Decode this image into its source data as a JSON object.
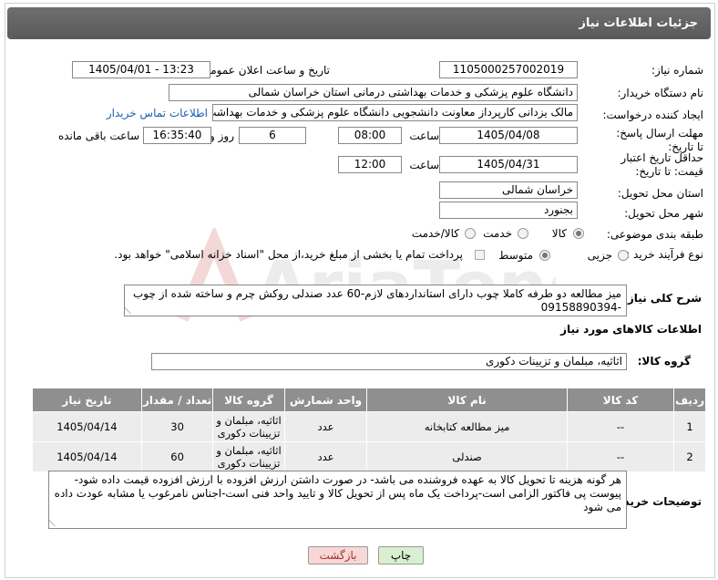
{
  "header": {
    "title": "جزئیات اطلاعات نیاز"
  },
  "fields": {
    "need_number_label": "شماره نیاز:",
    "need_number": "1105000257002019",
    "announce_label": "تاریخ و ساعت اعلان عمومی:",
    "announce_value": "1405/04/01 - 13:23",
    "buyer_org_label": "نام دستگاه خریدار:",
    "buyer_org": "دانشگاه علوم پزشکی و خدمات بهداشتی درمانی استان خراسان شمالی",
    "creator_label": "ایجاد کننده درخواست:",
    "creator": "مالک یزدانی کارپرداز معاونت دانشجویی دانشگاه علوم پزشکی و خدمات بهداشت",
    "contact_link": "اطلاعات تماس خریدار",
    "deadline_label": "مهلت ارسال پاسخ: تا تاریخ:",
    "deadline_date": "1405/04/08",
    "time_label": "ساعت",
    "deadline_time": "08:00",
    "days_value": "6",
    "days_label": "روز و",
    "remaining_time": "16:35:40",
    "remaining_label": "ساعت باقی مانده",
    "min_price_label": "حداقل تاریخ اعتبار قیمت: تا تاریخ:",
    "min_price_date": "1405/04/31",
    "min_price_time_label": "ساعت",
    "min_price_time": "12:00",
    "province_label": "استان محل تحویل:",
    "province": "خراسان شمالی",
    "city_label": "شهر محل تحویل:",
    "city": "بجنورد",
    "category_label": "طبقه بندی موضوعی:",
    "category_options": [
      "کالا",
      "خدمت",
      "کالا/خدمت"
    ],
    "process_label": "نوع فرآیند خرید :",
    "process_options": [
      "جزیی",
      "متوسط"
    ],
    "payment_note": "پرداخت تمام یا بخشی از مبلغ خرید،از محل \"اسناد خزانه اسلامی\" خواهد بود."
  },
  "description": {
    "label": "شرح کلی نیاز:",
    "text": "میز مطالعه دو طرفه کاملا چوب دارای استانداردهای لازم-60 عدد صندلی روکش چرم و ساخته شده از چوب -09158890394"
  },
  "goods": {
    "section_title": "اطلاعات کالاهای مورد نیاز",
    "group_label": "گروه کالا:",
    "group_value": "اثاثیه، مبلمان و تزیینات دکوری"
  },
  "table": {
    "headers": [
      "ردیف",
      "کد کالا",
      "نام کالا",
      "واحد شمارش",
      "گروه کالا",
      "تعداد / مقدار",
      "تاریخ نیاز"
    ],
    "rows": [
      [
        "1",
        "--",
        "میز مطالعه کتابخانه",
        "عدد",
        "اثاثیه، مبلمان و تزیینات دکوری",
        "30",
        "1405/04/14"
      ],
      [
        "2",
        "--",
        "صندلی",
        "عدد",
        "اثاثیه، مبلمان و تزیینات دکوری",
        "60",
        "1405/04/14"
      ]
    ]
  },
  "buyer_notes": {
    "label": "توضیحات خریدار:",
    "text": "هر گونه هزینه تا تحویل کالا به عهده فروشنده می باشد- در صورت داشتن ارزش افزوده با ارزش افزوده قیمت داده شود- پیوست پی فاکتور الزامی است-پرداخت یک ماه پس از تحویل کالا و تایید واحد فنی است-اجناس نامرغوب یا مشابه عودت داده می شود"
  },
  "buttons": {
    "print": "چاپ",
    "back": "بازگشت"
  },
  "watermark": "AriaTender.neT",
  "colors": {
    "header_bg": "#636363",
    "table_header_bg": "#8f8f8f",
    "link": "#1a5fb4",
    "back_btn_bg": "#f8d7d7",
    "print_btn_bg": "#d8f0d0"
  }
}
